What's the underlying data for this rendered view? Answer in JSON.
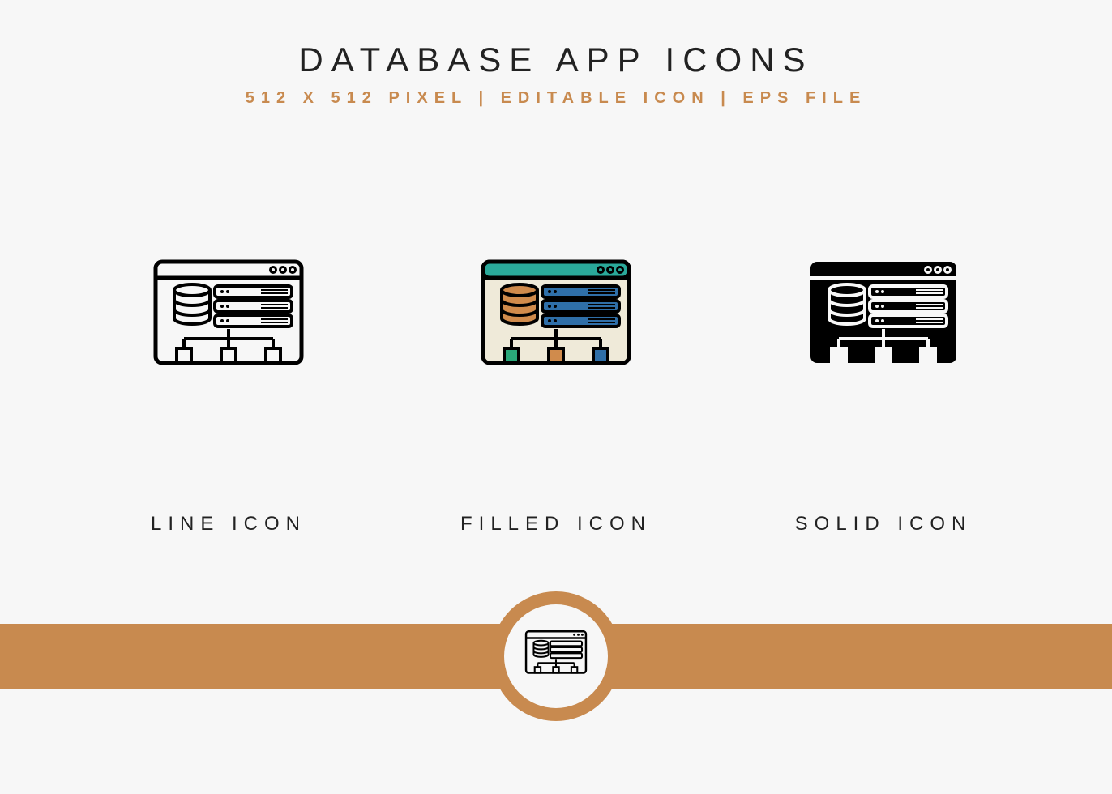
{
  "header": {
    "title": "DATABASE APP ICONS",
    "subtitle": "512 X 512 PIXEL | EDITABLE ICON | EPS FILE"
  },
  "icons": {
    "line_label": "LINE ICON",
    "filled_label": "FILLED ICON",
    "solid_label": "SOLID ICON"
  },
  "colors": {
    "accent": "#c88a4f",
    "teal": "#2aa99a",
    "blue": "#2f6fa8",
    "orange": "#d08b4c",
    "green": "#2aa87a",
    "cream": "#efead9"
  }
}
